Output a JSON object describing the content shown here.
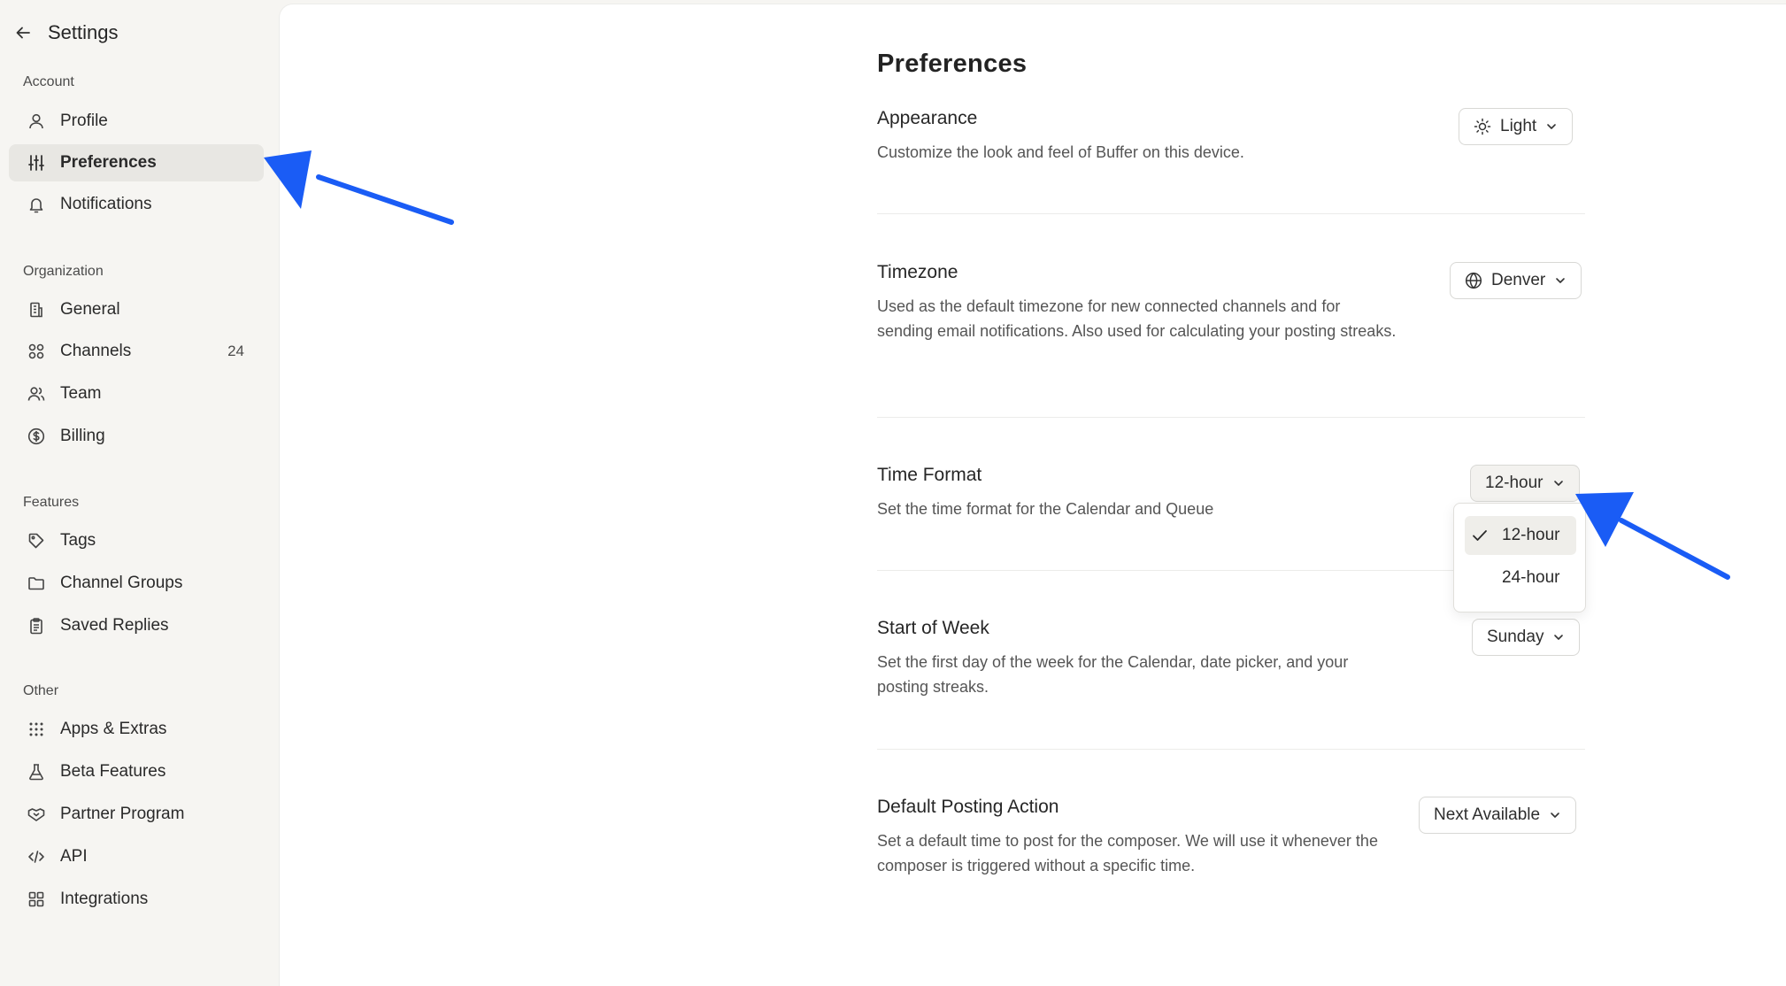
{
  "colors": {
    "accent_arrow": "#1a5cf5",
    "sidebar_bg": "#f6f5f2",
    "active_bg": "#e8e7e3"
  },
  "sidebar": {
    "title": "Settings",
    "sections": [
      {
        "label": "Account",
        "items": [
          {
            "label": "Profile",
            "icon": "user-icon"
          },
          {
            "label": "Preferences",
            "icon": "sliders-icon",
            "active": true
          },
          {
            "label": "Notifications",
            "icon": "bell-icon"
          }
        ]
      },
      {
        "label": "Organization",
        "items": [
          {
            "label": "General",
            "icon": "building-icon"
          },
          {
            "label": "Channels",
            "icon": "grid-circles-icon",
            "badge": "24"
          },
          {
            "label": "Team",
            "icon": "users-icon"
          },
          {
            "label": "Billing",
            "icon": "dollar-circle-icon"
          }
        ]
      },
      {
        "label": "Features",
        "items": [
          {
            "label": "Tags",
            "icon": "tag-icon"
          },
          {
            "label": "Channel Groups",
            "icon": "folder-icon"
          },
          {
            "label": "Saved Replies",
            "icon": "clipboard-icon"
          }
        ]
      },
      {
        "label": "Other",
        "items": [
          {
            "label": "Apps & Extras",
            "icon": "dots-grid-icon"
          },
          {
            "label": "Beta Features",
            "icon": "flask-icon"
          },
          {
            "label": "Partner Program",
            "icon": "handshake-icon"
          },
          {
            "label": "API",
            "icon": "code-icon"
          },
          {
            "label": "Integrations",
            "icon": "squares-grid-icon"
          }
        ]
      }
    ]
  },
  "main": {
    "title": "Preferences",
    "settings": [
      {
        "title": "Appearance",
        "description": "Customize the look and feel of Buffer on this device.",
        "value": "Light",
        "icon": "sun-icon"
      },
      {
        "title": "Timezone",
        "description": "Used as the default timezone for new connected channels and for sending email notifications. Also used for calculating your posting streaks.",
        "value": "Denver",
        "icon": "globe-icon"
      },
      {
        "title": "Time Format",
        "description": "Set the time format for the Calendar and Queue",
        "value": "12-hour"
      },
      {
        "title": "Start of Week",
        "description": "Set the first day of the week for the Calendar, date picker, and your posting streaks.",
        "value": "Sunday"
      },
      {
        "title": "Default Posting Action",
        "description": "Set a default time to post for the composer. We will use it whenever the composer is triggered without a specific time.",
        "value": "Next Available"
      }
    ],
    "time_format_menu": {
      "options": [
        "12-hour",
        "24-hour"
      ],
      "selected": "12-hour"
    }
  }
}
